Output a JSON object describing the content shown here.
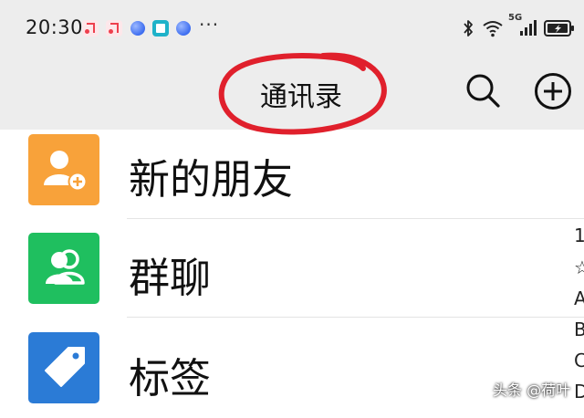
{
  "status_bar": {
    "time": "20:30",
    "more": "···",
    "network": "5G",
    "notification_icons": [
      "music-icon",
      "music-icon",
      "sphere-icon",
      "book-icon",
      "sphere-icon"
    ]
  },
  "header": {
    "title": "通讯录",
    "annotation_color": "#e0202c",
    "background": "#ededed"
  },
  "contacts_menu": {
    "items": [
      {
        "label": "新的朋友",
        "icon": "add-contact-icon",
        "color": "#f8a23a"
      },
      {
        "label": "群聊",
        "icon": "group-icon",
        "color": "#1fbf5f"
      },
      {
        "label": "标签",
        "icon": "tag-icon",
        "color": "#2b7bd6"
      }
    ]
  },
  "edge_clipped_text": [
    "1",
    "☆",
    "A",
    "B",
    "C",
    "D"
  ],
  "watermark": "头条 @荷叶"
}
